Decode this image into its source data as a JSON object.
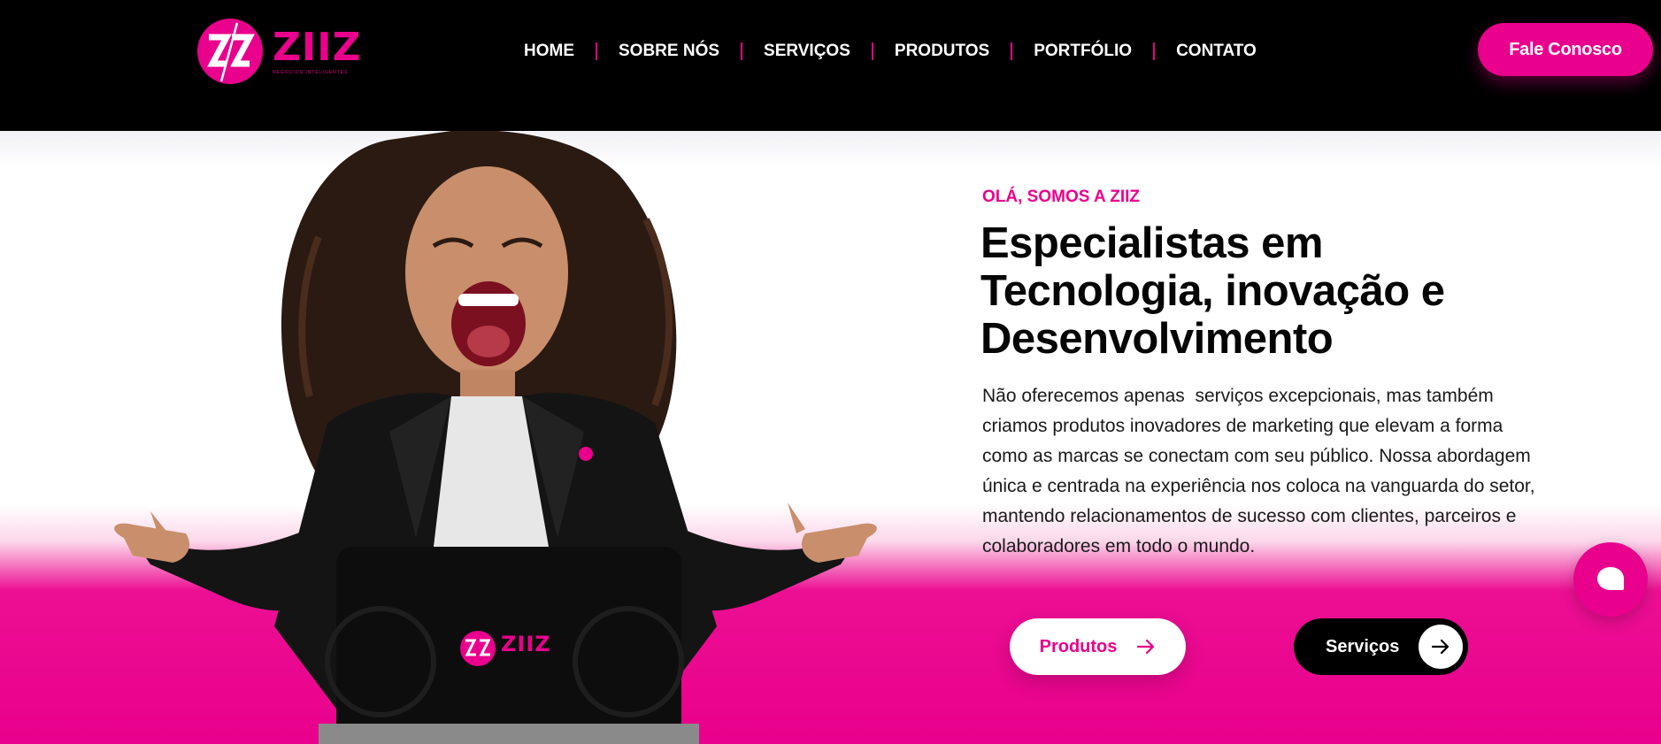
{
  "colors": {
    "brand": "#e9008c",
    "dark": "#000000",
    "white": "#ffffff"
  },
  "header": {
    "logo": {
      "word": "ZIIZ",
      "tagline": "NEGÓCIOS INTELIGENTES",
      "icon": "zz-logo-icon"
    },
    "nav": [
      "HOME",
      "SOBRE NÓS",
      "SERVIÇOS",
      "PRODUTOS",
      "PORTFÓLIO",
      "CONTATO"
    ],
    "cta_label": "Fale Conosco"
  },
  "hero": {
    "eyebrow": "OLÁ, SOMOS A ZIIZ",
    "headline": [
      "Especialistas em",
      "Tecnologia, inovação e",
      "Desenvolvimento"
    ],
    "paragraph": [
      "Não oferecemos apenas  serviços excepcionais, mas também",
      "criamos produtos inovadores de marketing que elevam a forma",
      "como as marcas se conectam com seu público. Nossa abordagem",
      "única e centrada na experiência nos coloca na vanguarda do setor,",
      "mantendo relacionamentos de sucesso com clientes, parceiros e",
      "colaboradores em todo o mundo."
    ],
    "laptop_logo": "ZIIZ",
    "buttons": {
      "produtos": {
        "label": "Produtos",
        "icon": "arrow-right-icon"
      },
      "servicos": {
        "label": "Serviços",
        "icon": "arrow-right-icon"
      }
    }
  },
  "chat": {
    "icon": "chat-bubble-icon"
  }
}
